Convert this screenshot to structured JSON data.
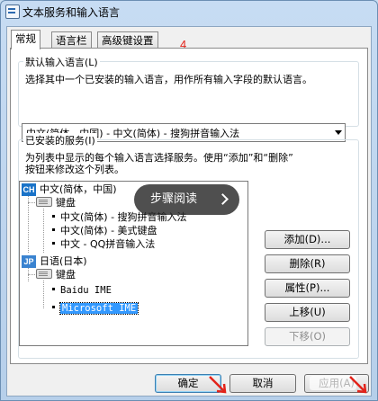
{
  "window": {
    "title": "文本服务和输入语言"
  },
  "tabs": [
    {
      "label": "常规"
    },
    {
      "label": "语言栏"
    },
    {
      "label": "高级键设置"
    }
  ],
  "annotation": {
    "step_number": "4"
  },
  "default_language": {
    "group_label": "默认输入语言(L)",
    "description": "选择其中一个已安装的输入语言，用作所有输入字段的默认语言。",
    "selected": "中文(简体，中国) - 中文(简体) - 搜狗拼音输入法"
  },
  "installed_services": {
    "group_label": "已安装的服务(I)",
    "description_line1": "为列表中显示的每个输入语言选择服务。使用“添加”和“删除”",
    "description_line2": "按钮来修改这个列表。",
    "tree": {
      "chinese": {
        "badge": "CH",
        "label": "中文(简体，中国)",
        "keyboard_label": "键盘",
        "items": [
          "中文(简体) - 搜狗拼音输入法",
          "中文(简体) - 美式键盘",
          "中文 - QQ拼音输入法"
        ]
      },
      "japanese": {
        "badge": "JP",
        "label": "日语(日本)",
        "keyboard_label": "键盘",
        "items": [
          "Baidu IME",
          "Microsoft IME"
        ]
      }
    }
  },
  "buttons": {
    "add": "添加(D)...",
    "remove": "删除(R)",
    "properties": "属性(P)...",
    "move_up": "上移(U)",
    "move_down": "下移(O)",
    "ok": "确定",
    "cancel": "取消",
    "apply": "应用(A)"
  },
  "overlay": {
    "label": "步骤阅读"
  },
  "colors": {
    "annotation_red": "#e2231a",
    "selection_blue": "#3399ff",
    "overlay_bg": "#282828"
  }
}
